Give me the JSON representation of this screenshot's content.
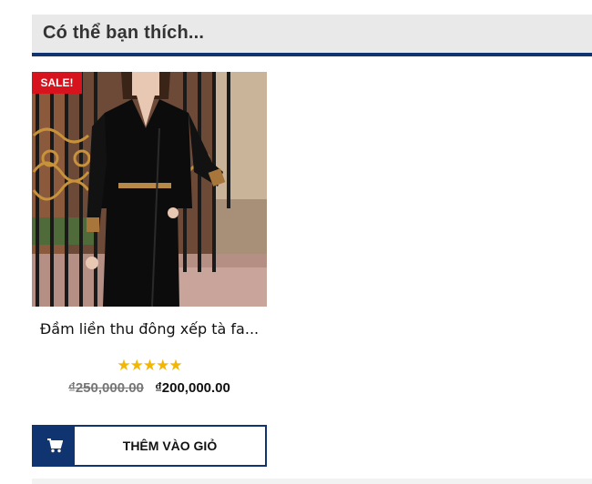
{
  "section": {
    "title": "Có thể bạn thích..."
  },
  "product": {
    "badge": "SALE!",
    "name": "Đầm liền thu đông xếp tà fa...",
    "rating_stars": "★★★★★",
    "rating_value": 5,
    "old_price": "₫250,000.00",
    "new_price": "₫200,000.00",
    "add_to_cart_label": "THÊM VÀO GIỎ",
    "image_icon": "product-photo"
  },
  "colors": {
    "brand_blue": "#0f3470",
    "sale_red": "#d7141e",
    "star_yellow": "#f2b605"
  }
}
